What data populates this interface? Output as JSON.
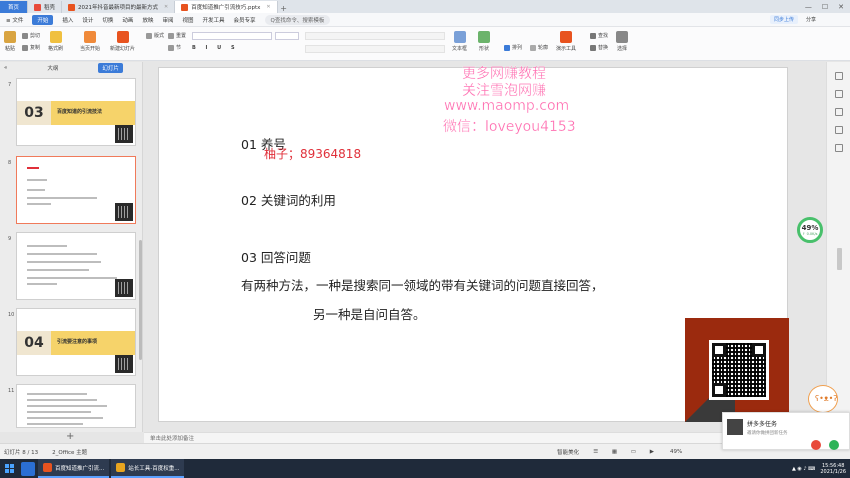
{
  "tabs": [
    {
      "label": "首页"
    },
    {
      "label": "稻壳"
    },
    {
      "label": "2021年抖音最新项目的最新方式"
    },
    {
      "label": "百度知道推广引流技巧.pptx"
    }
  ],
  "menu": {
    "file": "≡ 文件",
    "start": "开始",
    "items": [
      "插入",
      "设计",
      "切换",
      "动画",
      "放映",
      "审阅",
      "视图",
      "开发工具",
      "会员专享"
    ],
    "search": "Q查找命令、搜索模板",
    "cloud": "同步上传",
    "share": "分享"
  },
  "ribbon": {
    "paste": "粘贴",
    "cut": "剪切",
    "copy": "复制",
    "format": "格式刷",
    "from_current": "当页开始",
    "new_slide": "新建幻灯片",
    "layout": "版式",
    "section": "节",
    "reset": "重置",
    "textbox": "文本框",
    "shape": "形状",
    "arrange": "排列",
    "outline": "轮廓",
    "present": "演示工具",
    "find": "查找",
    "replace": "替换",
    "select": "选择"
  },
  "panel": {
    "outline_tab": "大纲",
    "thumb_tab": "幻灯片",
    "slide_numbers": [
      "7",
      "8",
      "9",
      "10",
      "11"
    ],
    "thumb7_num": "03",
    "thumb7_title": "百度知道的引流技法",
    "thumb10_num": "04",
    "thumb10_title": "引流要注意的事项"
  },
  "slide": {
    "l1": "01 养号",
    "red": "柚子；89364818",
    "l2": "02 关键词的利用",
    "l3": "03 回答问题",
    "l4": "有两种方法，一种是搜索同一领域的带有关键词的问题直接回答，",
    "l5": "另一种是自问自答。"
  },
  "watermark": {
    "w1": "更多网赚教程",
    "w2": "关注雪泡网赚",
    "w3": "www.maomp.com",
    "w4": "微信：loveyou4153"
  },
  "zoom": {
    "percent": "49%",
    "speed": "↑ 0.0K/s"
  },
  "notes": "单击此处添加备注",
  "status": {
    "slide": "幻灯片 8 / 13",
    "theme": "2_Office 主题",
    "smart": "智能美化",
    "zoom": "49%"
  },
  "popup": {
    "title": "拼多多任务",
    "subtitle": "邀请你做拼团新任务"
  },
  "mascot": "ʕ•ᴥ•ʔ",
  "taskbar": {
    "app1": "百度知道推广引流...",
    "app2": "站长工具-百度权重..."
  },
  "clock": {
    "time": "15:56:48",
    "date": "2021/1/26"
  },
  "colors": {
    "accent": "#3b7bd8",
    "slide_red": "#e0303a",
    "watermark": "#ff4fa0",
    "qr_bg": "#9b2a0e"
  }
}
